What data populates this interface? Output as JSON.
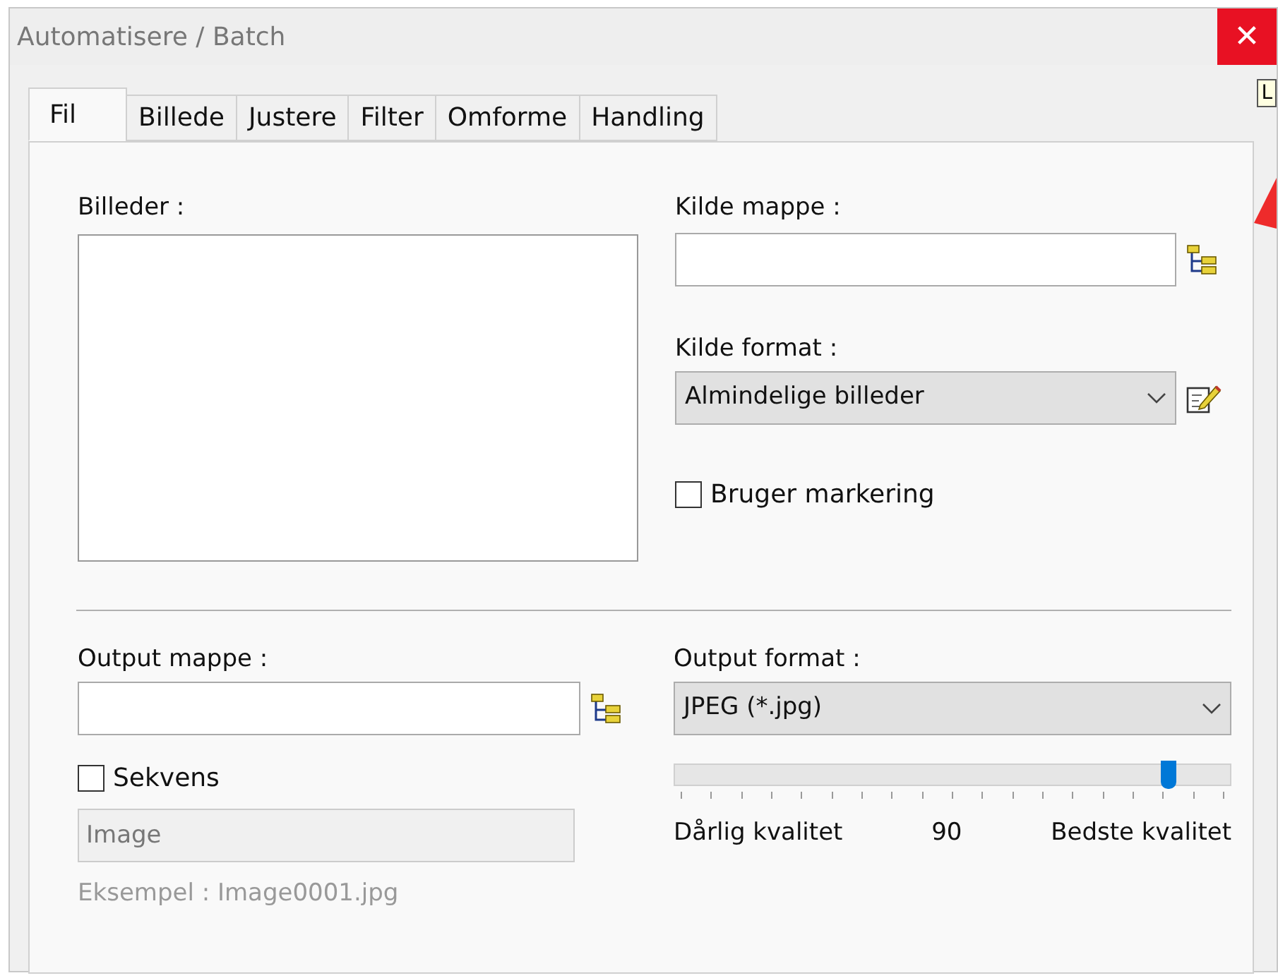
{
  "window": {
    "title": "Automatisere / Batch",
    "close": "✕"
  },
  "tooltip": "L",
  "tabs": [
    {
      "label": "Fil",
      "selected": true
    },
    {
      "label": "Billede",
      "selected": false
    },
    {
      "label": "Justere",
      "selected": false
    },
    {
      "label": "Filter",
      "selected": false
    },
    {
      "label": "Omforme",
      "selected": false
    },
    {
      "label": "Handling",
      "selected": false
    }
  ],
  "images": {
    "label": "Billeder :"
  },
  "source_folder": {
    "label": "Kilde mappe :"
  },
  "source_format": {
    "label": "Kilde format :",
    "value": "Almindelige billeder"
  },
  "use_selection": {
    "label": "Bruger markering",
    "checked": false
  },
  "output_folder": {
    "label": "Output mappe :"
  },
  "sequence": {
    "label": "Sekvens",
    "checked": false
  },
  "sequence_name": {
    "placeholder": "Image"
  },
  "example": "Eksempel : Image0001.jpg",
  "output_format": {
    "label": "Output format :",
    "value": "JPEG (*.jpg)"
  },
  "quality": {
    "level": 0.9,
    "low_label": "Dårlig kvalitet",
    "reading": "90",
    "high_label": "Bedste kvalitet"
  }
}
